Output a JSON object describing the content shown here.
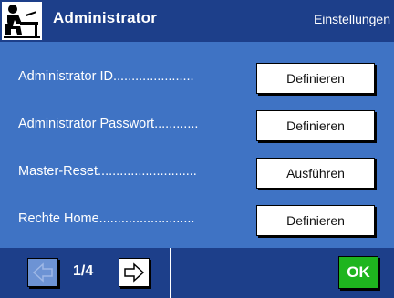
{
  "header": {
    "title": "Administrator",
    "context": "Einstellungen"
  },
  "rows": [
    {
      "label": "Administrator ID",
      "dots": "......................",
      "button": "Definieren"
    },
    {
      "label": "Administrator Passwort",
      "dots": "............",
      "button": "Definieren"
    },
    {
      "label": "Master-Reset",
      "dots": "...........................",
      "button": "Ausführen"
    },
    {
      "label": "Rechte Home",
      "dots": "..........................",
      "button": "Definieren"
    }
  ],
  "footer": {
    "page": "1/4",
    "ok_label": "OK"
  },
  "colors": {
    "background": "#3f73c4",
    "bars": "#1d3f8a",
    "ok": "#1eb51e",
    "prev_disabled": "#6d93d4"
  }
}
